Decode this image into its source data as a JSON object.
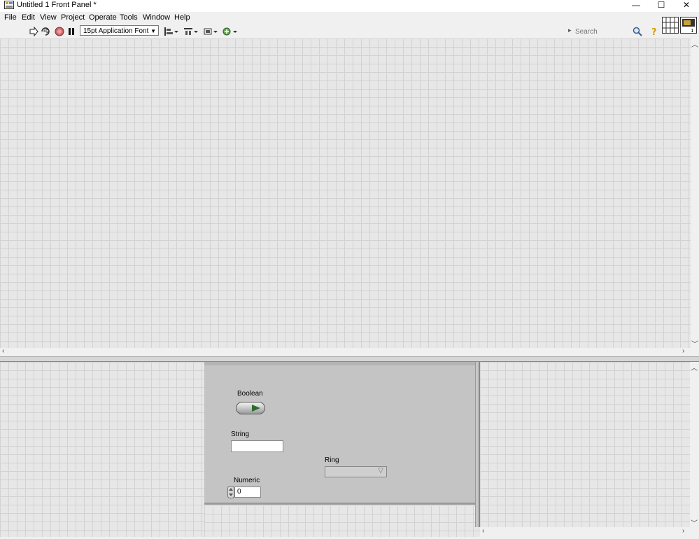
{
  "window": {
    "title": "Untitled 1 Front Panel *",
    "minimize_glyph": "—",
    "maximize_glyph": "☐",
    "close_glyph": "✕"
  },
  "menu": {
    "items": [
      "File",
      "Edit",
      "View",
      "Project",
      "Operate",
      "Tools",
      "Window",
      "Help"
    ]
  },
  "toolbar": {
    "font": "15pt Application Font",
    "search_placeholder": "Search",
    "icons": [
      "run-arrow-icon",
      "run-continuously-icon",
      "abort-icon",
      "pause-icon",
      "align-objects-icon",
      "distribute-objects-icon",
      "resize-objects-icon",
      "reorder-icon",
      "help-icon",
      "search-icon"
    ]
  },
  "panel": {
    "controls": {
      "boolean_label": "Boolean",
      "string_label": "String",
      "string_value": "",
      "ring_label": "Ring",
      "ring_value": "",
      "numeric_label": "Numeric",
      "numeric_value": "0"
    }
  },
  "colors": {
    "panel": "#c4c4c4",
    "grid_bg": "#e7e7e7",
    "grid_line": "#d2d2d2",
    "led": "#2b6b2b"
  }
}
